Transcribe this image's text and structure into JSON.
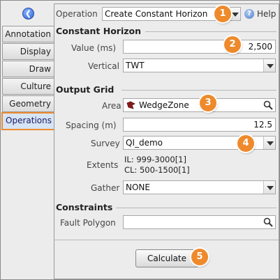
{
  "sidebar": {
    "back_icon": "back-arrow-icon",
    "tabs": [
      {
        "label": "Annotation"
      },
      {
        "label": "Display"
      },
      {
        "label": "Draw"
      },
      {
        "label": "Culture"
      },
      {
        "label": "Geometry"
      },
      {
        "label": "Operations",
        "active": true
      }
    ]
  },
  "header": {
    "operation_label": "Operation",
    "operation_value": "Create Constant Horizon",
    "help_label": "Help"
  },
  "constant_horizon": {
    "title": "Constant Horizon",
    "value_label": "Value (ms)",
    "value": "2,500",
    "vertical_label": "Vertical",
    "vertical_value": "TWT"
  },
  "output_grid": {
    "title": "Output Grid",
    "area_label": "Area",
    "area_value": "WedgeZone",
    "spacing_label": "Spacing (m)",
    "spacing_value": "12.5",
    "survey_label": "Survey",
    "survey_value": "QI_demo",
    "extents_label": "Extents",
    "extents_il": "IL: 999-3000[1]",
    "extents_cl": "CL: 500-1500[1]",
    "gather_label": "Gather",
    "gather_value": "NONE"
  },
  "constraints": {
    "title": "Constraints",
    "fault_polygon_label": "Fault Polygon",
    "fault_polygon_value": ""
  },
  "actions": {
    "calculate_label": "Calculate"
  },
  "badges": [
    "1",
    "2",
    "3",
    "4",
    "5"
  ],
  "colors": {
    "accent_orange": "#ee8a2c",
    "active_tab_bg": "#d6e4f5"
  }
}
